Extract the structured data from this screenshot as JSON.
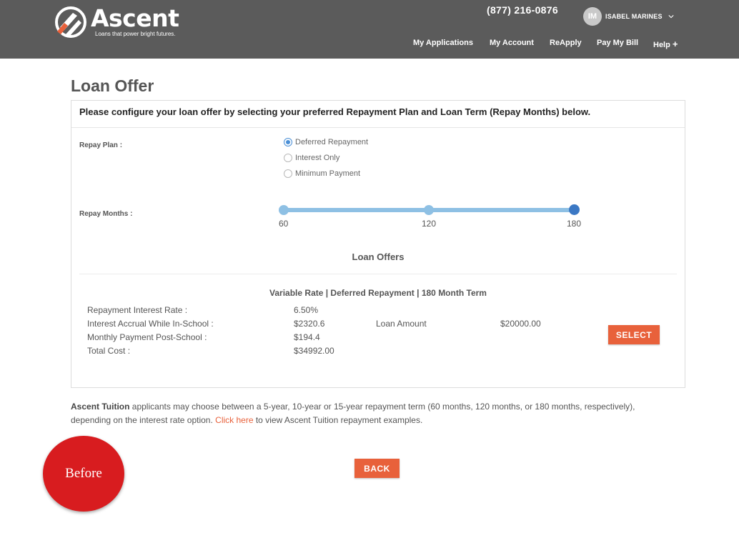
{
  "header": {
    "logo_name": "Ascent",
    "logo_tagline": "Loans that power bright futures.",
    "phone": "(877) 216-0876",
    "user_initials": "IM",
    "user_name": "ISABEL MARINES",
    "nav": [
      "My Applications",
      "My Account",
      "ReApply",
      "Pay My Bill",
      "Help"
    ],
    "help_suffix": "+",
    "colors": {
      "header_bg": "#5b5b5b",
      "logo_orange": "#e8613b"
    },
    "icons": [
      "ascent-logo-icon",
      "chevron-down-icon"
    ]
  },
  "page": {
    "title": "Loan Offer"
  },
  "config": {
    "instruction": "Please configure your loan offer by selecting your preferred Repayment Plan and Loan Term (Repay Months) below.",
    "repay_plan_label": "Repay Plan :",
    "repay_plans": [
      "Deferred Repayment",
      "Interest Only",
      "Minimum Payment"
    ],
    "repay_plan_selected": "Deferred Repayment",
    "repay_months_label": "Repay Months :",
    "repay_months_ticks": [
      "60",
      "120",
      "180"
    ],
    "repay_months_selected": 180,
    "slider_color": "#8ec0e4",
    "slider_active_color": "#3b78c4"
  },
  "offers": {
    "title": "Loan Offers",
    "offer_heading": "Variable Rate | Deferred Repayment | 180 Month Term",
    "rows": [
      {
        "label": "Repayment Interest Rate :",
        "value": "6.50%"
      },
      {
        "label": "Interest Accrual While In-School :",
        "value": "$2320.6"
      },
      {
        "label": "Monthly Payment Post-School :",
        "value": "$194.4"
      },
      {
        "label": "Total Cost :",
        "value": "$34992.00"
      }
    ],
    "loan_amount_label": "Loan Amount",
    "loan_amount_value": "$20000.00",
    "select_label": "SELECT",
    "button_color": "#e8613b"
  },
  "note": {
    "brand": "Ascent Tuition",
    "text_before_link": " applicants may choose between a 5-year, 10-year or 15-year repayment term (60 months, 120 months, or 180 months, respectively), depending on the interest rate option. ",
    "link_text": "Click here",
    "text_after_link": " to view Ascent Tuition repayment examples."
  },
  "footer": {
    "back_label": "BACK"
  },
  "badge": {
    "text": "Before",
    "color": "#d81c1f"
  }
}
